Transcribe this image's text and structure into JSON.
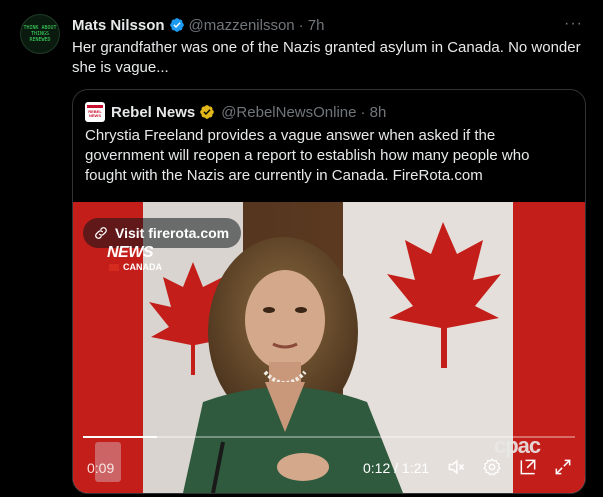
{
  "tweet": {
    "avatar_text": "THINK ABOUT THINGS RENEWED",
    "name": "Mats Nilsson",
    "handle": "@mazzenilsson",
    "time": "· 7h",
    "more": "···",
    "text": "Her grandfather was one of the Nazis granted asylum in Canada. No wonder she is vague..."
  },
  "quote": {
    "logo_text": "REBEL NEWS",
    "name": "Rebel News",
    "handle": "@RebelNewsOnline",
    "time": "· 8h",
    "text": "Chrystia Freeland provides a vague answer when asked if the government will reopen a report to establish how many people who fought with the Nazis are currently in Canada. FireRota.com"
  },
  "video": {
    "link_label": "Visit firerota.com",
    "news_logo": "NEWS",
    "canada_label": "CANADA",
    "watermark": "cpac",
    "time_left": "0:09",
    "time": "0:12 / 1:21",
    "progress": 0.15,
    "controls": [
      "mute-icon",
      "settings-icon",
      "popout-icon",
      "fullscreen-icon"
    ]
  },
  "colors": {
    "background": "#000000",
    "text": "#e7e9ea",
    "muted": "#71767b",
    "verified_blue": "#1d9bf0",
    "verified_gold": "#e2b719",
    "flag_red": "#d52b1e"
  }
}
